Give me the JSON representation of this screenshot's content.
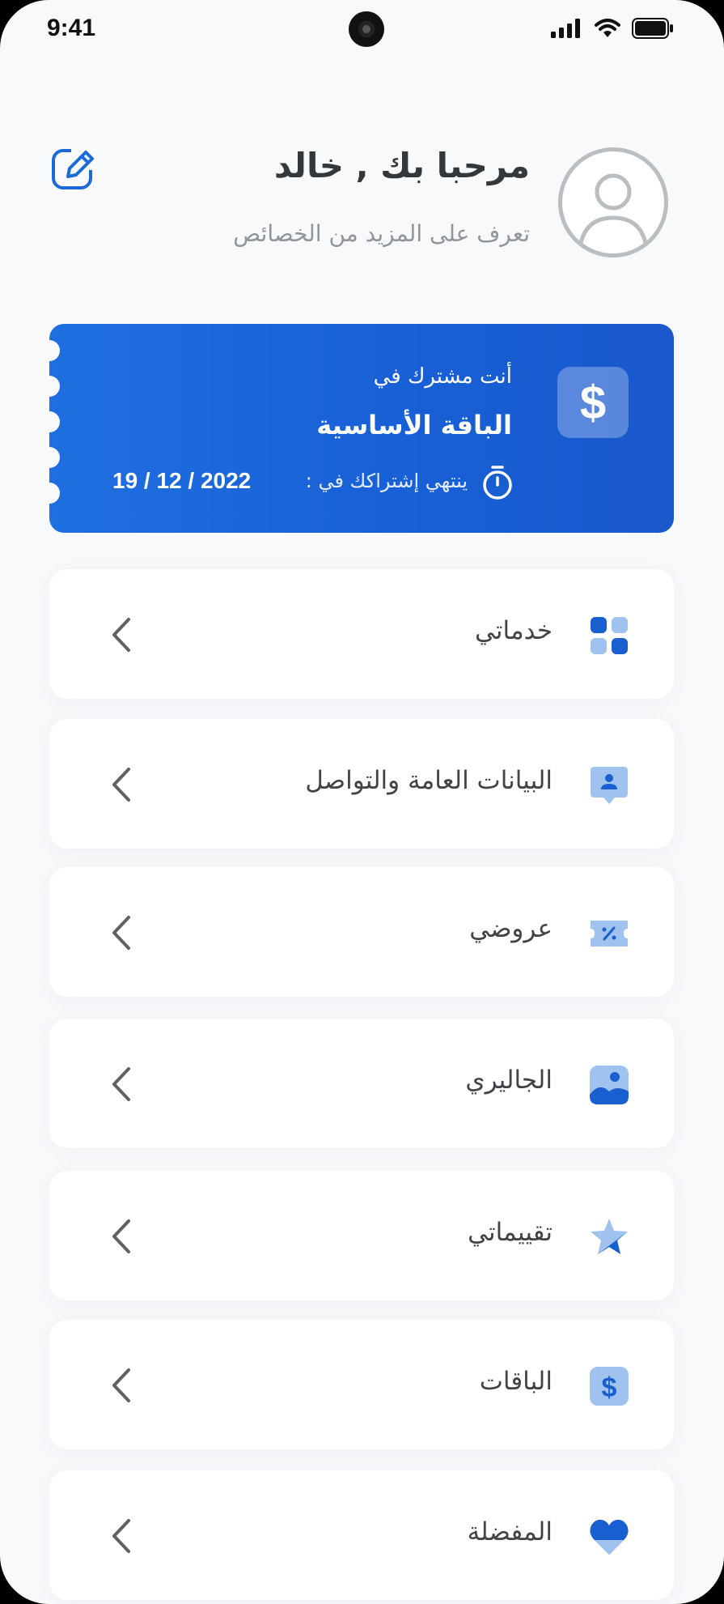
{
  "status_bar": {
    "time": "9:41"
  },
  "header": {
    "greeting": "مرحبا بك , خالد",
    "subtitle": "تعرف على المزيد من الخصائص"
  },
  "subscription": {
    "label": "أنت مشترك في",
    "plan": "الباقة الأساسية",
    "expiry_label": "ينتهي إشتراكك في :",
    "expiry_date": "19 / 12 / 2022",
    "currency_symbol": "$"
  },
  "menu": [
    {
      "label": "خدماتي",
      "icon": "grid-icon"
    },
    {
      "label": "البيانات العامة والتواصل",
      "icon": "contact-card-icon"
    },
    {
      "label": "عروضي",
      "icon": "discount-ticket-icon"
    },
    {
      "label": "الجاليري",
      "icon": "gallery-image-icon"
    },
    {
      "label": "تقييماتي",
      "icon": "star-icon"
    },
    {
      "label": "الباقات",
      "icon": "dollar-icon"
    },
    {
      "label": "المفضلة",
      "icon": "heart-icon"
    }
  ],
  "colors": {
    "accent": "#1a62d8",
    "accent_light": "#9fc2ee",
    "background": "#f8f9fb",
    "text_dark": "#33383c",
    "text_muted": "#8f959a"
  }
}
